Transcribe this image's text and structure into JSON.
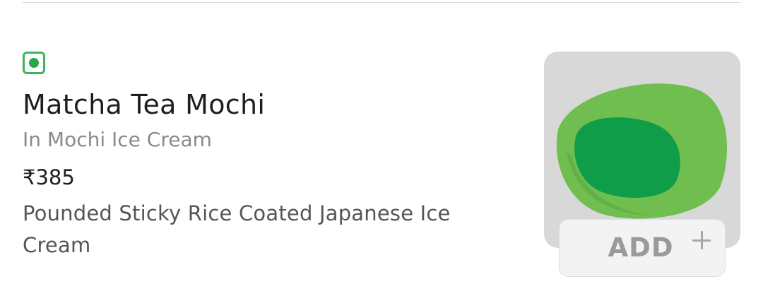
{
  "item": {
    "veg_indicator": "veg-icon",
    "name": "Matcha Tea Mochi",
    "category": "In Mochi Ice Cream",
    "price": "₹385",
    "description": "Pounded Sticky Rice Coated Japanese Ice Cream",
    "image": "matcha-mochi-image"
  },
  "add_button": {
    "label": "ADD",
    "icon": "plus-icon"
  },
  "colors": {
    "veg_green": "#3db65a",
    "mochi_outer": "#6fbe4f",
    "mochi_inner": "#0f9d49",
    "button_text": "#9a9a9a"
  }
}
